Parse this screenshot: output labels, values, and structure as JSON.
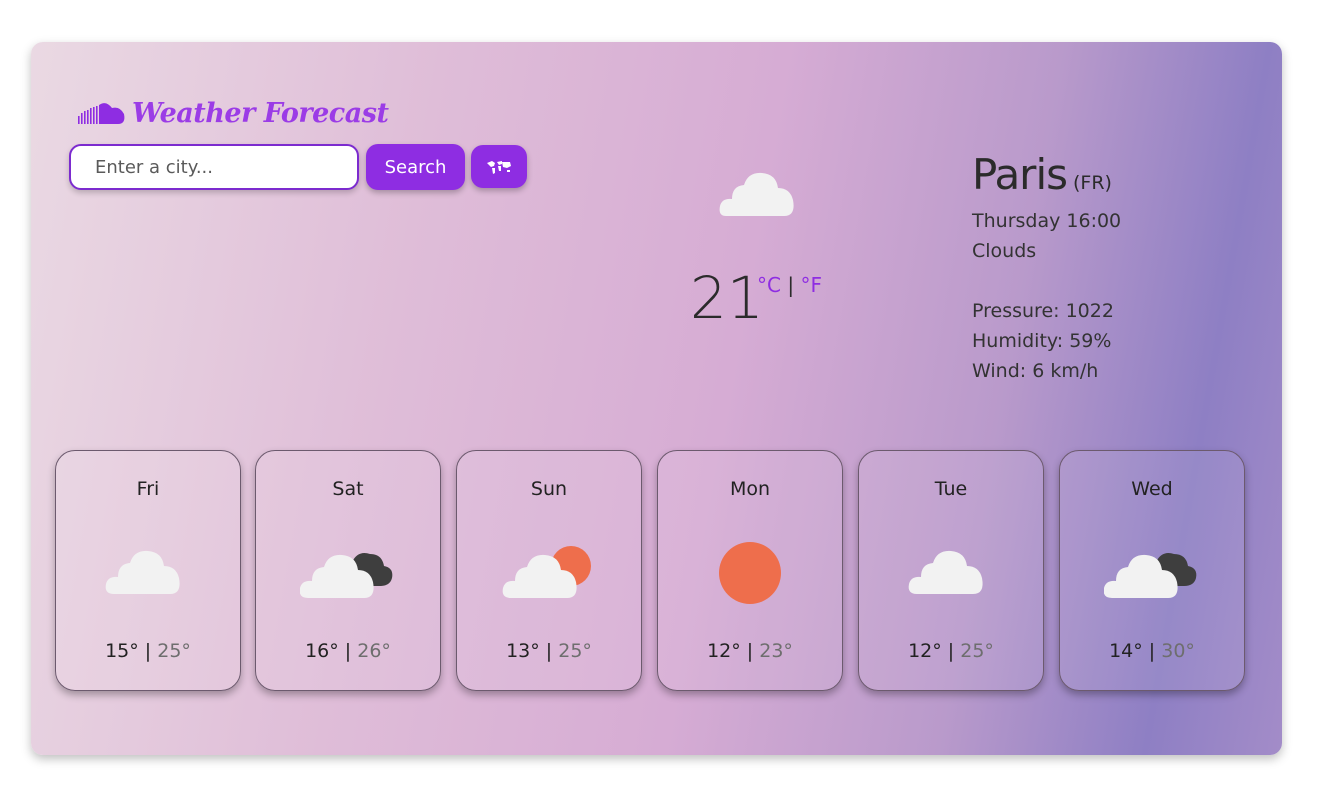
{
  "app": {
    "title": "Weather Forecast",
    "brand_color": "#8e2de2"
  },
  "search": {
    "placeholder": "Enter a city...",
    "value": "",
    "button_label": "Search",
    "location_icon": "world-map-icon"
  },
  "current": {
    "icon": "cloud-icon",
    "temperature": "21",
    "unit_c": "°C",
    "unit_separator": "|",
    "unit_f": "°F",
    "city": "Paris",
    "country": "(FR)",
    "datetime": "Thursday 16:00",
    "condition": "Clouds",
    "pressure": "Pressure: 1022",
    "humidity": "Humidity: 59%",
    "wind": "Wind: 6 km/h"
  },
  "forecast": [
    {
      "day": "Fri",
      "min": "15°",
      "sep": "|",
      "max": "25°",
      "icon": "cloud-icon"
    },
    {
      "day": "Sat",
      "min": "16°",
      "sep": "|",
      "max": "26°",
      "icon": "cloud-dark-cloud-icon"
    },
    {
      "day": "Sun",
      "min": "13°",
      "sep": "|",
      "max": "25°",
      "icon": "cloud-sun-icon"
    },
    {
      "day": "Mon",
      "min": "12°",
      "sep": "|",
      "max": "23°",
      "icon": "sun-icon"
    },
    {
      "day": "Tue",
      "min": "12°",
      "sep": "|",
      "max": "25°",
      "icon": "cloud-icon"
    },
    {
      "day": "Wed",
      "min": "14°",
      "sep": "|",
      "max": "30°",
      "icon": "cloud-dark-cloud-icon"
    }
  ]
}
